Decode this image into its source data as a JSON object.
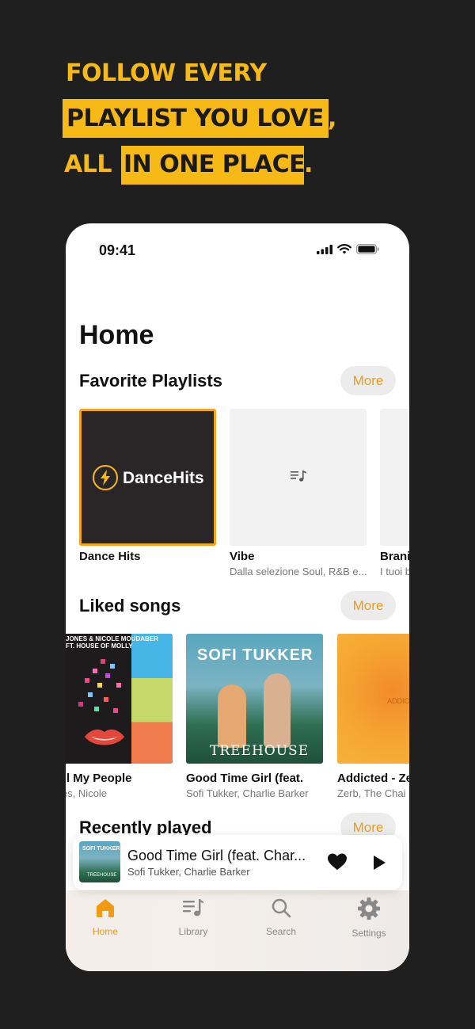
{
  "promo": {
    "line1": "FOLLOW EVERY",
    "line2": "PLAYLIST YOU LOVE",
    "line2_mark": ",",
    "line3a": "ALL",
    "line3b": "IN ONE PLACE",
    "line3_mark": "."
  },
  "status_bar": {
    "time": "09:41"
  },
  "page_title": "Home",
  "favorite_playlists": {
    "title": "Favorite Playlists",
    "more_label": "More",
    "items": [
      {
        "title": "Dance Hits",
        "subtitle": "",
        "art_logo_text": "DanceHits",
        "icon": "bolt-icon"
      },
      {
        "title": "Vibe",
        "subtitle": "Dalla selezione Soul, R&B e...",
        "icon": "playlist-icon"
      },
      {
        "title": "Brani",
        "subtitle": "I tuoi b"
      }
    ]
  },
  "liked_songs": {
    "title": "Liked songs",
    "more_label": "More",
    "items": [
      {
        "title": "e All My People",
        "artist": "Jones, Nicole",
        "art_text": "JONES & NICOLE MOUDABER\nFT. HOUSE OF MOLLY"
      },
      {
        "title": "Good Time Girl (feat.",
        "artist": "Sofi Tukker, Charlie Barker",
        "art_text_top": "SOFI TUKKER",
        "art_text_bottom": "TREEHOUSE"
      },
      {
        "title": "Addicted - Ze",
        "artist": "Zerb, The Chai",
        "art_text": "ADDIC"
      }
    ]
  },
  "recently_played": {
    "title": "Recently played",
    "more_label": "More"
  },
  "mini_player": {
    "title": "Good Time Girl (feat. Char...",
    "artist": "Sofi Tukker, Charlie Barker",
    "liked": true
  },
  "tab_bar": {
    "tabs": [
      {
        "label": "Home",
        "icon": "home-icon",
        "active": true
      },
      {
        "label": "Library",
        "icon": "library-icon",
        "active": false
      },
      {
        "label": "Search",
        "icon": "search-icon",
        "active": false
      },
      {
        "label": "Settings",
        "icon": "gear-icon",
        "active": false
      }
    ]
  },
  "colors": {
    "accent": "#f6b915",
    "tab_active": "#f29a12",
    "background": "#1f1f1f"
  }
}
